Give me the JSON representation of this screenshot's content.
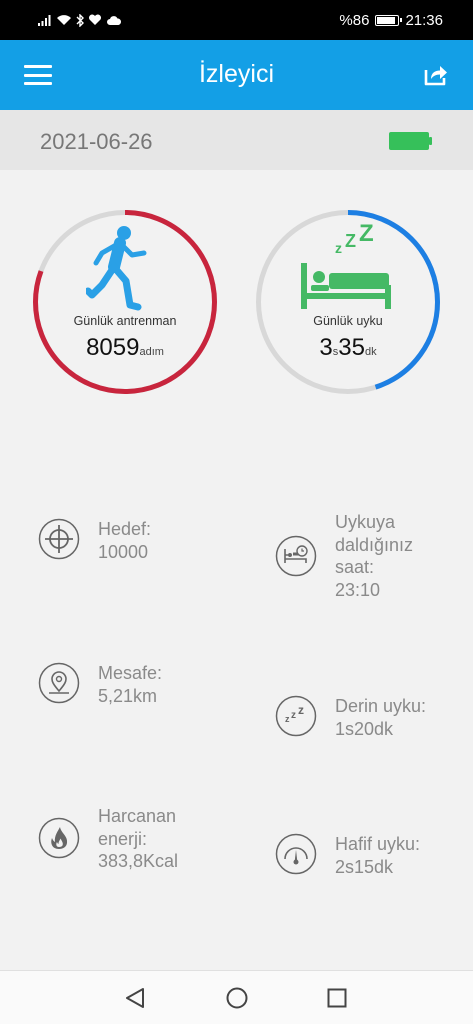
{
  "status_bar": {
    "battery_percent": "%86",
    "time": "21:36",
    "battery_level": 0.86
  },
  "app_bar": {
    "title": "İzleyici",
    "menu_icon": "menu-icon",
    "share_icon": "share-icon"
  },
  "date_bar": {
    "date": "2021-06-26",
    "device_battery_icon": "battery-full-icon",
    "device_battery_color": "#36c05a"
  },
  "activity": {
    "label": "Günlük antrenman",
    "steps": "8059",
    "unit": "adım",
    "progress": 0.8059,
    "accent": "#c8253d",
    "figure_color": "#2aa0e6"
  },
  "sleep": {
    "label": "Günlük uyku",
    "hours": "3",
    "hours_unit": "s",
    "minutes": "35",
    "minutes_unit": "dk",
    "progress": 0.45,
    "accent": "#1d7fe3",
    "figure_color": "#45b965",
    "zzz": "zZZ"
  },
  "stats_left": [
    {
      "icon": "target-icon",
      "lines": [
        "Hedef:",
        "10000"
      ]
    },
    {
      "icon": "location-pin-icon",
      "lines": [
        "Mesafe:",
        "5,21km"
      ]
    },
    {
      "icon": "flame-icon",
      "lines": [
        "Harcanan",
        "enerji:",
        "383,8Kcal"
      ]
    }
  ],
  "stats_right": [
    {
      "icon": "bed-clock-icon",
      "lines": [
        "Uykuya",
        "daldığınız",
        "saat:",
        "23:10"
      ]
    },
    {
      "icon": "deep-sleep-zzz-icon",
      "lines": [
        "Derin uyku:",
        "1s20dk"
      ]
    },
    {
      "icon": "light-sleep-gauge-icon",
      "lines": [
        "Hafif uyku:",
        "2s15dk"
      ]
    }
  ],
  "nav_bar": {
    "back_icon": "back-triangle-icon",
    "home_icon": "home-circle-icon",
    "recents_icon": "recents-square-icon"
  }
}
